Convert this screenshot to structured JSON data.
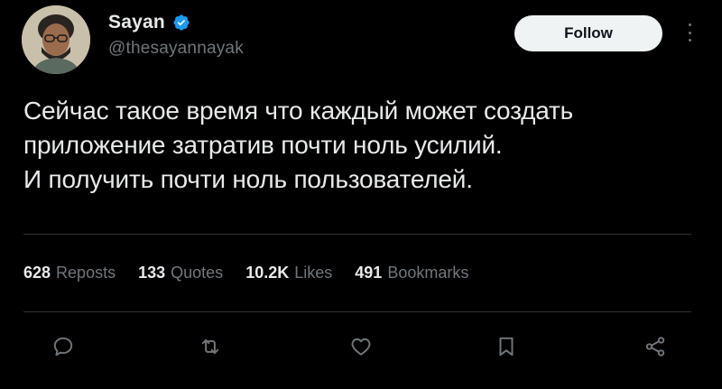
{
  "author": {
    "display_name": "Sayan",
    "handle": "@thesayannayak",
    "verified": true,
    "verified_color": "#1d9bf0"
  },
  "follow_button": {
    "label": "Follow"
  },
  "tweet": {
    "lines": [
      "Сейчас такое время что каждый может создать",
      "приложение затратив почти ноль усилий.",
      "И получить почти ноль пользователей."
    ]
  },
  "stats": [
    {
      "value": "628",
      "label": "Reposts"
    },
    {
      "value": "133",
      "label": "Quotes"
    },
    {
      "value": "10.2K",
      "label": "Likes"
    },
    {
      "value": "491",
      "label": "Bookmarks"
    }
  ],
  "actions": [
    "reply-icon",
    "repost-icon",
    "like-icon",
    "bookmark-icon",
    "share-icon"
  ],
  "colors": {
    "background": "#000000",
    "text": "#e7e9ea",
    "muted": "#71767b",
    "divider": "#2f3336"
  }
}
